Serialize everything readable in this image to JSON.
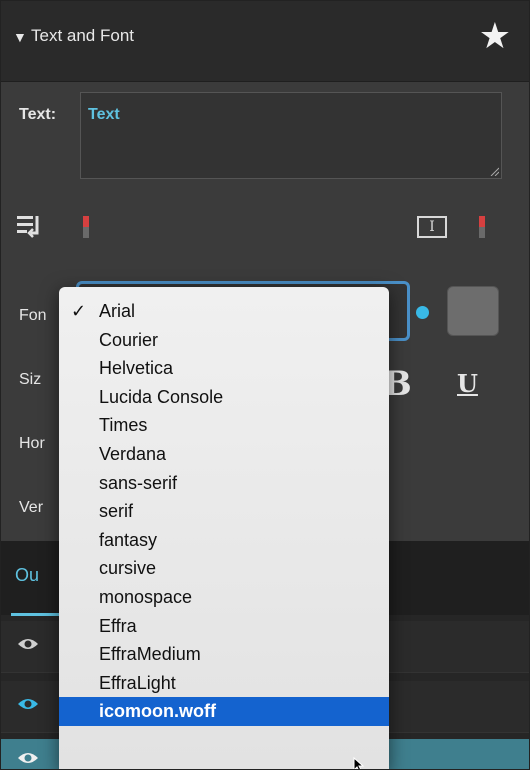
{
  "panel": {
    "title": "Text and Font",
    "text_label": "Text:",
    "text_value": "Text"
  },
  "rows": {
    "font_label": "Fon",
    "size_label": "Siz",
    "horizontal_label": "Hor",
    "vertical_label": "Ver"
  },
  "style_buttons": {
    "bold_label": "B",
    "underline_label": "U"
  },
  "bottom": {
    "tab_label": "Ou"
  },
  "dropdown": {
    "checked_item": "Arial",
    "selected_item": "icomoon.woff",
    "items": [
      "Arial",
      "Courier",
      "Helvetica",
      "Lucida Console",
      "Times",
      "Verdana",
      "sans-serif",
      "serif",
      "fantasy",
      "cursive",
      "monospace",
      "Effra",
      "EffraMedium",
      "EffraLight",
      "icomoon.woff"
    ]
  },
  "colors": {
    "accent": "#5fc2e0",
    "selection": "#1463cf",
    "focus_border": "#4a90c8",
    "marker_red": "#d64040"
  },
  "icons": {
    "collapse": "triangle-down-icon",
    "favorite": "star-icon",
    "wrap": "text-wrap-icon",
    "textbox": "text-box-icon",
    "visibility": "eye-icon",
    "pointer": "mouse-cursor-icon",
    "check": "checkmark-icon"
  }
}
